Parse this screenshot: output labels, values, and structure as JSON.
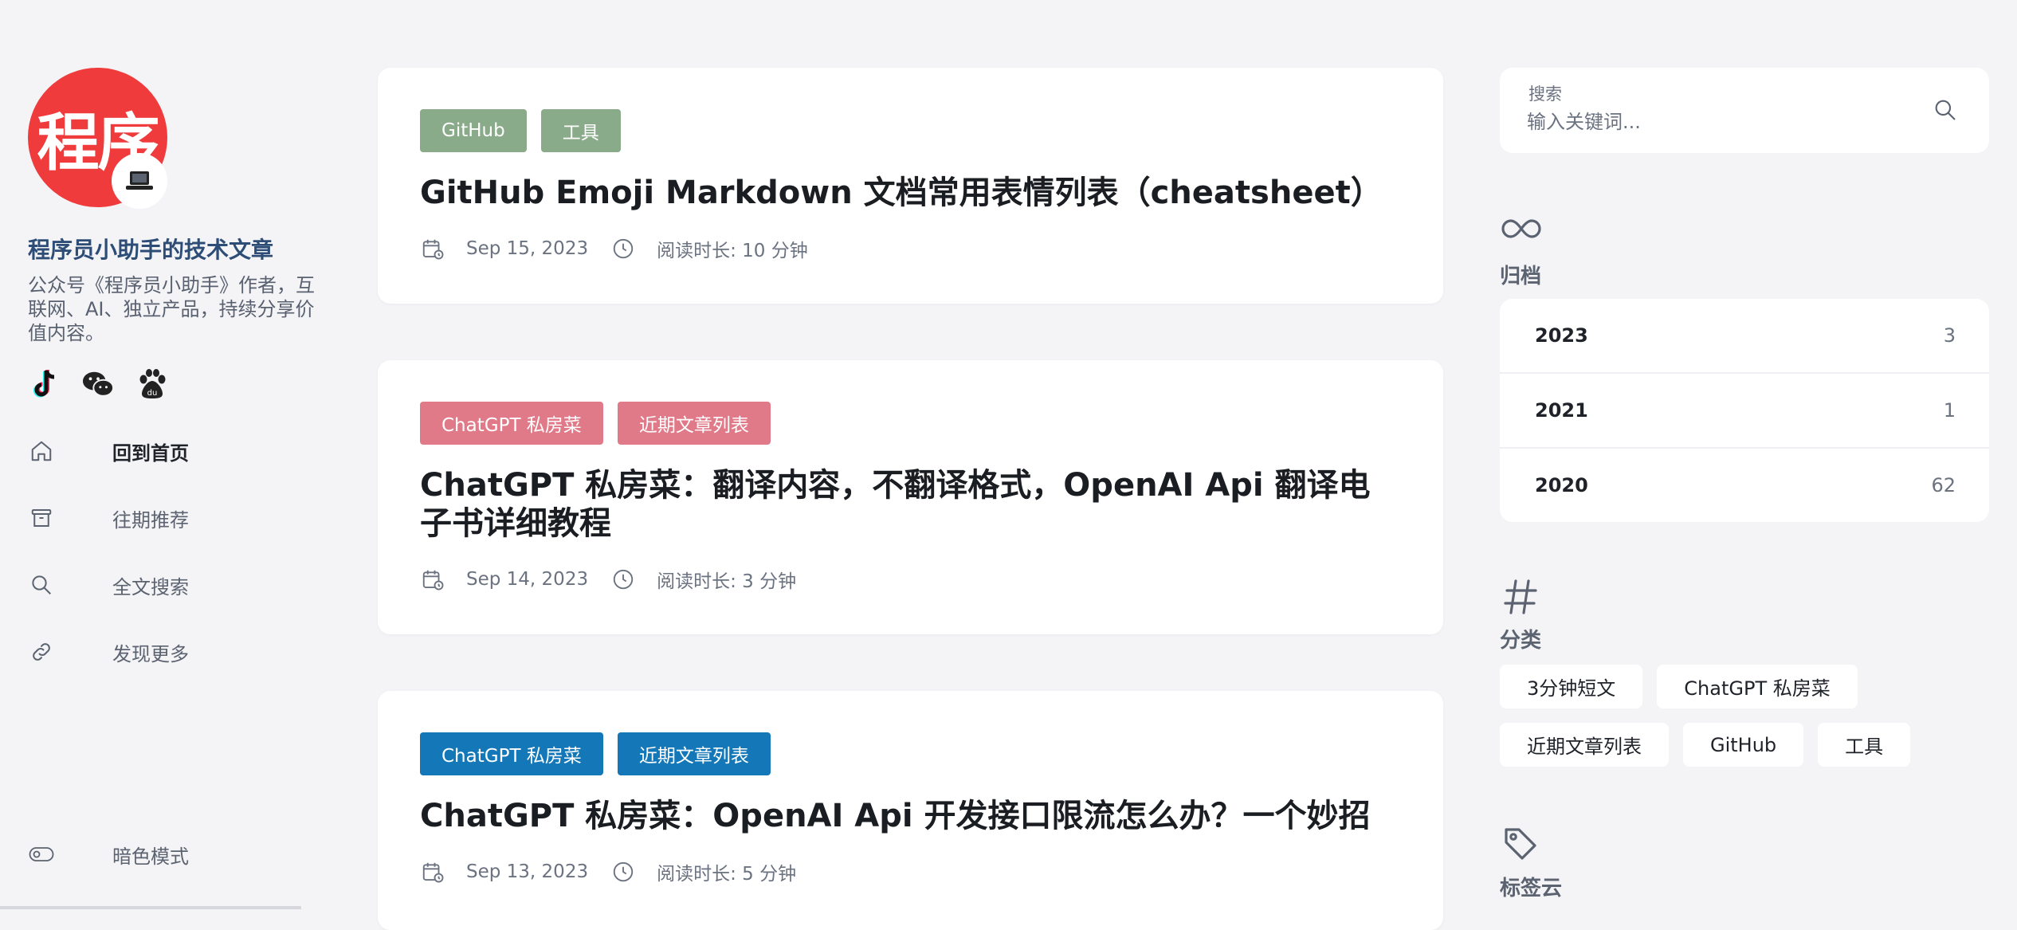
{
  "profile": {
    "avatar_text": "程序",
    "avatar_badge": "laptop-icon",
    "site_title": "程序员小助手的技术文章",
    "site_desc": "公众号《程序员小助手》作者，互联网、AI、独立产品，持续分享价值内容。",
    "socials": [
      "tiktok-icon",
      "wechat-icon",
      "baidu-icon"
    ]
  },
  "nav": {
    "home": "回到首页",
    "archives": "往期推荐",
    "search": "全文搜索",
    "more": "发现更多",
    "dark_mode": "暗色模式"
  },
  "posts": [
    {
      "tags": [
        "GitHub",
        "工具"
      ],
      "tag_color": "#8aab89",
      "title": "GitHub Emoji Markdown 文档常用表情列表（cheatsheet）",
      "date": "Sep 15, 2023",
      "read_time": "阅读时长: 10 分钟"
    },
    {
      "tags": [
        "ChatGPT 私房菜",
        "近期文章列表"
      ],
      "tag_color": "#e07a88",
      "title": "ChatGPT 私房菜：翻译内容，不翻译格式，OpenAI Api 翻译电子书详细教程",
      "date": "Sep 14, 2023",
      "read_time": "阅读时长: 3 分钟"
    },
    {
      "tags": [
        "ChatGPT 私房菜",
        "近期文章列表"
      ],
      "tag_color": "#1477b8",
      "title": "ChatGPT 私房菜：OpenAI Api 开发接口限流怎么办？一个妙招",
      "date": "Sep 13, 2023",
      "read_time": "阅读时长: 5 分钟"
    }
  ],
  "search": {
    "label": "搜索",
    "placeholder": "输入关键词..."
  },
  "archive": {
    "heading": "归档",
    "items": [
      {
        "year": "2023",
        "count": "3"
      },
      {
        "year": "2021",
        "count": "1"
      },
      {
        "year": "2020",
        "count": "62"
      }
    ]
  },
  "categories": {
    "heading": "分类",
    "items": [
      "3分钟短文",
      "ChatGPT 私房菜",
      "近期文章列表",
      "GitHub",
      "工具"
    ]
  },
  "tagcloud": {
    "heading": "标签云"
  }
}
